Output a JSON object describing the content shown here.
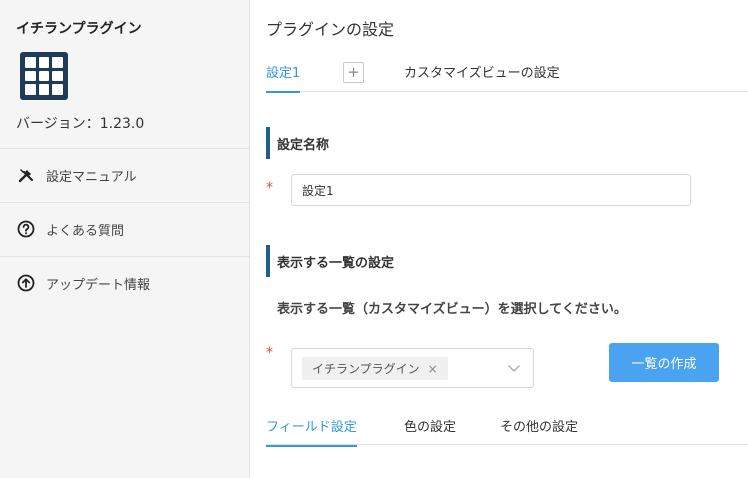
{
  "sidebar": {
    "plugin_name": "イチランプラグイン",
    "app_icon": "grid-icon",
    "version": "バージョン：1.23.0",
    "nav": [
      {
        "label": "設定マニュアル",
        "icon": "tools-icon"
      },
      {
        "label": "よくある質問",
        "icon": "question-circle-icon"
      },
      {
        "label": "アップデート情報",
        "icon": "arrow-up-circle-icon"
      }
    ]
  },
  "main": {
    "title": "プラグインの設定",
    "tabs": [
      {
        "label": "設定1",
        "active": true
      },
      {
        "label": "カスタマイズビューの設定",
        "active": false
      }
    ],
    "add_tab_label": "+",
    "setting_name": {
      "heading": "設定名称",
      "required_mark": "*",
      "value": "設定1"
    },
    "list_setting": {
      "heading": "表示する一覧の設定",
      "instruction": "表示する一覧（カスタマイズビュー）を選択してください。",
      "required_mark": "*",
      "selected_chip": "イチランプラグイン",
      "chip_close": "×",
      "create_button": "一覧の作成"
    },
    "sub_tabs": [
      {
        "label": "フィールド設定",
        "active": true
      },
      {
        "label": "色の設定",
        "active": false
      },
      {
        "label": "その他の設定",
        "active": false
      }
    ]
  },
  "colors": {
    "accent": "#3498db",
    "button": "#4aa3f0",
    "section_bar": "#1f5f8b",
    "icon_bg": "#1f3b57",
    "required": "#e74c3c"
  }
}
